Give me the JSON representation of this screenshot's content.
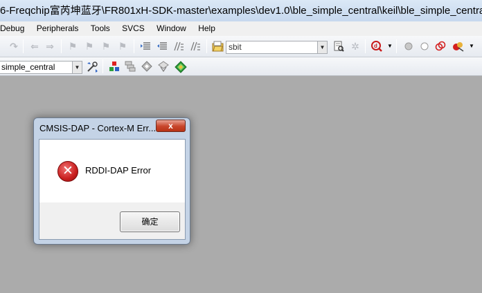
{
  "window": {
    "title": "6-Freqchip富芮坤蓝牙\\FR801xH-SDK-master\\examples\\dev1.0\\ble_simple_central\\keil\\ble_simple_central.uvproj - µVision"
  },
  "menu": [
    "Debug",
    "Peripherals",
    "Tools",
    "SVCS",
    "Window",
    "Help"
  ],
  "toolbar": {
    "find_combo_value": "sbit",
    "target_combo_value": "simple_central"
  },
  "dialog": {
    "title": "CMSIS-DAP - Cortex-M Err...",
    "close_label": "x",
    "message": "RDDI-DAP Error",
    "ok_label": "确定"
  }
}
